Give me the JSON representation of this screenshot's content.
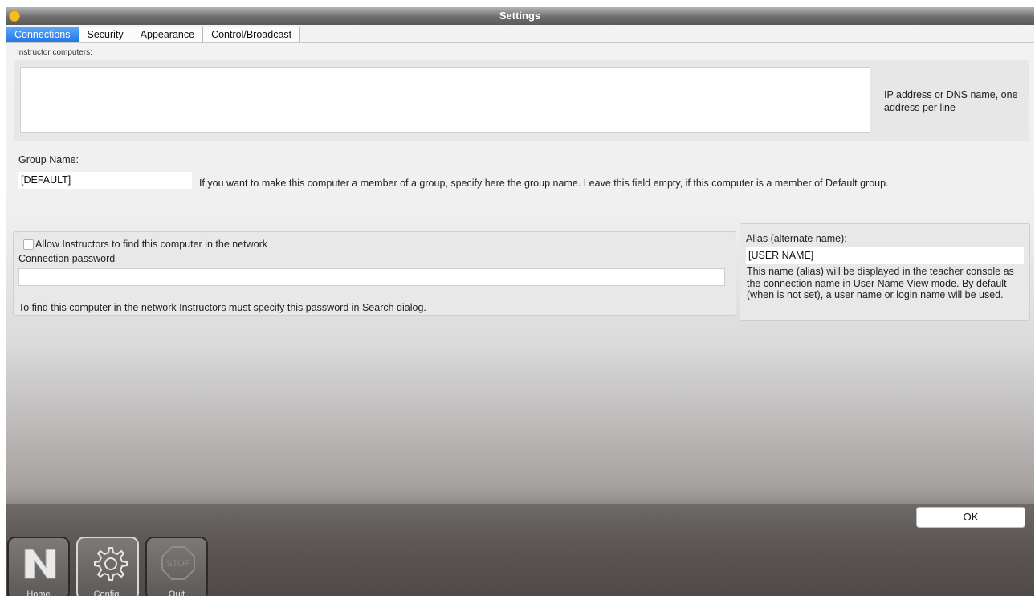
{
  "window": {
    "title": "Settings"
  },
  "tabs": [
    {
      "label": "Connections",
      "active": true
    },
    {
      "label": "Security",
      "active": false
    },
    {
      "label": "Appearance",
      "active": false
    },
    {
      "label": "Control/Broadcast",
      "active": false
    }
  ],
  "instructor": {
    "label": "Instructor computers:",
    "value": "",
    "hint": "IP address or DNS name, one address per line"
  },
  "group": {
    "label": "Group Name:",
    "value": "[DEFAULT]",
    "hint": "If you want to make this computer a member of a group, specify here the group name. Leave this field empty, if this computer is a member of Default group."
  },
  "connection": {
    "allow_label": "Allow Instructors to find this computer in the network",
    "allow_checked": false,
    "password_label": "Connection password",
    "password_value": "",
    "password_hint": "To find this computer in the network Instructors must specify this password in Search dialog."
  },
  "alias": {
    "label": "Alias (alternate name):",
    "value": "[USER NAME]",
    "description": "This name (alias) will be displayed in the teacher console as the connection name in User Name View mode. By default (when is not set), a user name or login name will be used."
  },
  "ok_label": "OK",
  "dock": [
    {
      "label": "Home",
      "icon": "home-n-logo-icon",
      "active": false
    },
    {
      "label": "Config.",
      "icon": "gear-icon",
      "active": true
    },
    {
      "label": "Quit",
      "icon": "stop-sign-icon",
      "active": false
    }
  ],
  "colors": {
    "tab_active": "#2075e6",
    "traffic_light": "#f4be22"
  }
}
